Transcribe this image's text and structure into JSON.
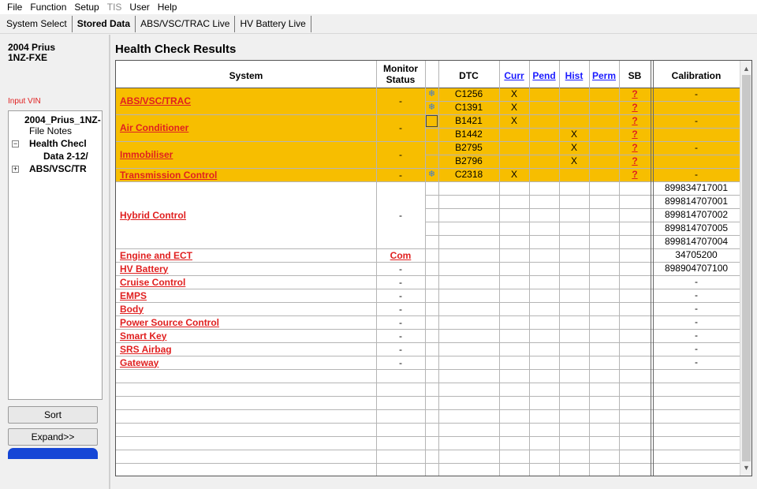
{
  "menu": [
    "File",
    "Function",
    "Setup",
    "TIS",
    "User",
    "Help"
  ],
  "tabs": [
    "System Select",
    "Stored Data",
    "ABS/VSC/TRAC Live",
    "HV Battery Live"
  ],
  "vehicle": {
    "model": "2004 Prius",
    "engine": "1NZ-FXE"
  },
  "input_vin_label": "Input VIN",
  "tree": {
    "root": "2004_Prius_1NZ-",
    "file_notes": "File Notes",
    "health_check": "Health Checl",
    "data": "Data 2-12/",
    "abs": "ABS/VSC/TR"
  },
  "buttons": {
    "sort": "Sort",
    "expand": "Expand>>"
  },
  "title": "Health Check Results",
  "headers": {
    "system": "System",
    "monitor_status": "Monitor Status",
    "dtc": "DTC",
    "curr": "Curr",
    "pend": "Pend",
    "hist": "Hist",
    "perm": "Perm",
    "sb": "SB",
    "calibration": "Calibration"
  },
  "highlight_color": "#f7be00",
  "systems": [
    {
      "name": "ABS/VSC/TRAC",
      "status": "-",
      "calibration": "-",
      "highlight": true,
      "rows": 2
    },
    {
      "name": "Air Conditioner",
      "status": "-",
      "calibration": "-",
      "highlight": true,
      "rows": 2
    },
    {
      "name": "Immobiliser",
      "status": "-",
      "calibration": "-",
      "highlight": true,
      "rows": 2
    },
    {
      "name": "Transmission Control",
      "status": "-",
      "calibration": "-",
      "highlight": true,
      "rows": 1
    },
    {
      "name": "Hybrid Control",
      "status": "-",
      "rows": 5,
      "calibrations": [
        "899834717001",
        "899814707001",
        "899814707002",
        "899814707005",
        "899814707004"
      ]
    },
    {
      "name": "Engine and ECT",
      "status": "Com",
      "calibration": "34705200",
      "rows": 1
    },
    {
      "name": "HV Battery",
      "status": "-",
      "calibration": "898904707100",
      "rows": 1
    },
    {
      "name": "Cruise Control",
      "status": "-",
      "calibration": "-",
      "rows": 1
    },
    {
      "name": "EMPS",
      "status": "-",
      "calibration": "-",
      "rows": 1
    },
    {
      "name": "Body",
      "status": "-",
      "calibration": "-",
      "rows": 1
    },
    {
      "name": "Power Source Control",
      "status": "-",
      "calibration": "-",
      "rows": 1
    },
    {
      "name": "Smart Key",
      "status": "-",
      "calibration": "-",
      "rows": 1
    },
    {
      "name": "SRS Airbag",
      "status": "-",
      "calibration": "-",
      "rows": 1
    },
    {
      "name": "Gateway",
      "status": "-",
      "calibration": "-",
      "rows": 1
    }
  ],
  "dtcs": [
    {
      "code": "C1256",
      "curr": "X",
      "pend": "",
      "hist": "",
      "perm": "",
      "sb": "?",
      "icon": "snowflake-icon"
    },
    {
      "code": "C1391",
      "curr": "X",
      "pend": "",
      "hist": "",
      "perm": "",
      "sb": "?",
      "icon": "snowflake-icon"
    },
    {
      "code": "B1421",
      "curr": "X",
      "pend": "",
      "hist": "",
      "perm": "",
      "sb": "?",
      "icon": "empty-box-icon"
    },
    {
      "code": "B1442",
      "curr": "",
      "pend": "",
      "hist": "X",
      "perm": "",
      "sb": "?",
      "icon": ""
    },
    {
      "code": "B2795",
      "curr": "",
      "pend": "",
      "hist": "X",
      "perm": "",
      "sb": "?",
      "icon": ""
    },
    {
      "code": "B2796",
      "curr": "",
      "pend": "",
      "hist": "X",
      "perm": "",
      "sb": "?",
      "icon": ""
    },
    {
      "code": "C2318",
      "curr": "X",
      "pend": "",
      "hist": "",
      "perm": "",
      "sb": "?",
      "icon": "snowflake-icon"
    }
  ]
}
